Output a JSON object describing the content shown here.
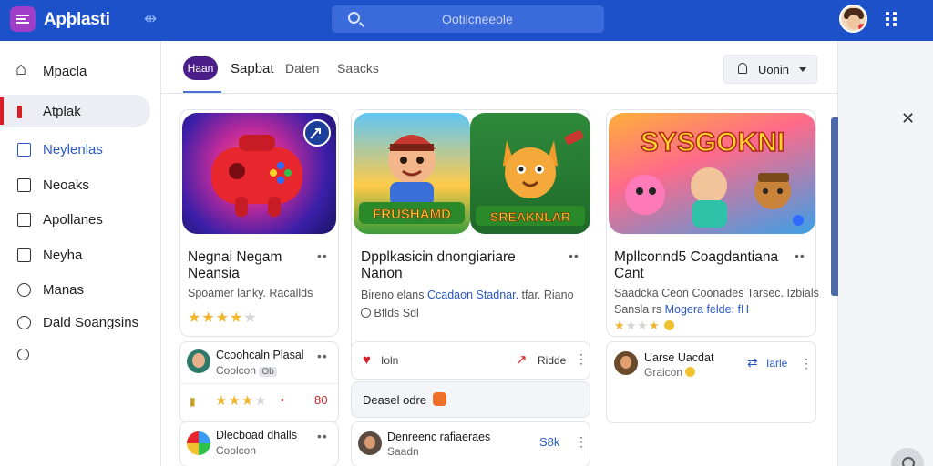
{
  "header": {
    "app_title": "Apþlasti",
    "search_placeholder": "Ootilcneeole"
  },
  "sidebar": {
    "items": [
      {
        "label": "Mpacla",
        "icon": "home-icon"
      },
      {
        "label": "Atplak",
        "icon": "app-icon"
      },
      {
        "label": "Neylenlas",
        "icon": "square-icon"
      },
      {
        "label": "Neoaks",
        "icon": "square-icon"
      },
      {
        "label": "Apollanes",
        "icon": "square-icon"
      },
      {
        "label": "Neyha",
        "icon": "square-icon"
      },
      {
        "label": "Manas",
        "icon": "circle-icon"
      },
      {
        "label": "Dald Soangsins",
        "icon": "settings-icon"
      },
      {
        "label": "",
        "icon": "help-icon"
      }
    ]
  },
  "tabs": {
    "active": "Haan",
    "items": [
      "Sapbat",
      "Daten",
      "Saacks"
    ]
  },
  "sort_button": {
    "label": "Uonin"
  },
  "cards": [
    {
      "title_line1": "Negnai Negam",
      "title_line2": "Neansia",
      "subtitle": "Spoamer lanky. Racallds",
      "rating": 4
    },
    {
      "title_line1": "Dpplkasicin dnongiariare",
      "title_line2": "Nanon",
      "subtitle_prefix": "Bireno elans",
      "subtitle_link": "Ccadaon Stadnar.",
      "subtitle_suffix": "tfar. Riano",
      "meta": "Bflds Sdl",
      "art_text": "FRUSHAMD",
      "art_text2": "SREAKNLAR"
    },
    {
      "title_line1": "Mpllconnd5 Coagdantiana",
      "title_line2": "Cant",
      "subtitle_line1": "Saadcka Ceon Coonades Tarsec. Izbials",
      "subtitle_prefix": "Sansla rs",
      "subtitle_link": "Mogera felde: fH",
      "rating": 2,
      "art_text": "SYSGOKNI"
    }
  ],
  "rows": [
    {
      "name": "Ccoohcaln Plasal",
      "meta": "Coolcon",
      "badge": "Ob"
    },
    {
      "value": "80",
      "rating": 3
    },
    {
      "name": "Dlecboad dhalls",
      "meta": "Coolcon"
    },
    {
      "left_label": "Ioln",
      "right_label": "Ridde"
    },
    {
      "label": "Deasel odre"
    },
    {
      "name": "Denreenc rafiaeraes",
      "meta": "Saadn",
      "value": "S8k"
    },
    {
      "name": "Uarse Uacdat",
      "meta": "Graicon",
      "link": "Iarle"
    }
  ],
  "colors": {
    "topbar": "#1d51c9",
    "accent_purple": "#4a1d89",
    "active_red": "#d91f26",
    "link_blue": "#2a58c7",
    "star": "#f1b42f"
  }
}
